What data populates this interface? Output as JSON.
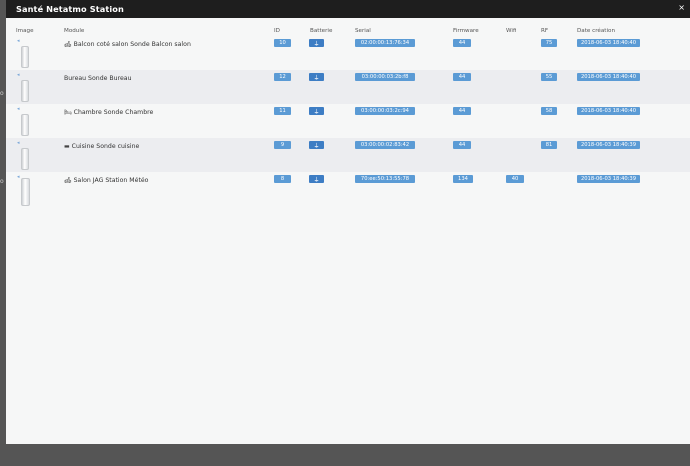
{
  "background": {
    "left_marks": [
      "o",
      "o"
    ]
  },
  "modal": {
    "title": "Santé Netatmo Station",
    "close_label": "×"
  },
  "table": {
    "columns": {
      "image": "Image",
      "module": "Module",
      "id": "ID",
      "battery": "Batterie",
      "serial": "Serial",
      "firmware": "Firmware",
      "wifi": "Wifi",
      "rf": "RF",
      "created": "Date création"
    },
    "rows": [
      {
        "icon": "sofa-icon",
        "icon_glyph": "🛋",
        "module": "Balcon coté salon Sonde Balcon salon",
        "id": "10",
        "battery_glyph": "⏚",
        "serial": "02:00:00:13:76:34",
        "firmware": "44",
        "wifi": "",
        "rf": "75",
        "created": "2018-06-03 18:40:40"
      },
      {
        "icon": "",
        "icon_glyph": "",
        "module": "Bureau Sonde Bureau",
        "id": "12",
        "battery_glyph": "⏚",
        "serial": "03:00:00:03:2b:f8",
        "firmware": "44",
        "wifi": "",
        "rf": "55",
        "created": "2018-06-03 18:40:40"
      },
      {
        "icon": "bed-icon",
        "icon_glyph": "🛏",
        "module": "Chambre Sonde Chambre",
        "id": "11",
        "battery_glyph": "⏚",
        "serial": "03:00:00:03:2c:94",
        "firmware": "44",
        "wifi": "",
        "rf": "58",
        "created": "2018-06-03 18:40:40"
      },
      {
        "icon": "stove-icon",
        "icon_glyph": "▬",
        "module": "Cuisine Sonde cuisine",
        "id": "9",
        "battery_glyph": "⏚",
        "serial": "03:00:00:02:83:42",
        "firmware": "44",
        "wifi": "",
        "rf": "81",
        "created": "2018-06-03 18:40:39"
      },
      {
        "icon": "sofa-icon",
        "icon_glyph": "🛋",
        "module": "Salon JAG Station Météo",
        "id": "8",
        "battery_glyph": "⏚",
        "serial": "70:ee:50:13:55:78",
        "firmware": "134",
        "wifi": "40",
        "rf": "",
        "created": "2018-06-03 18:40:39"
      }
    ]
  }
}
